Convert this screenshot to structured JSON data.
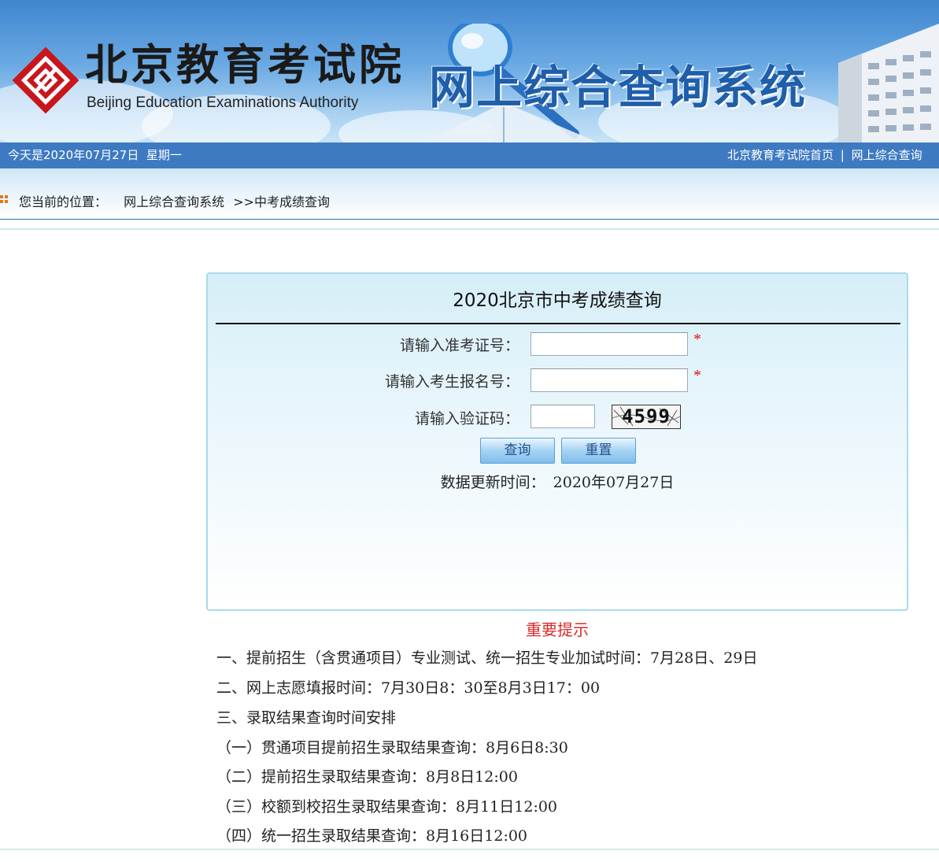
{
  "header": {
    "org_name_cn": "北京教育考试院",
    "org_name_en": "Beijing Education Examinations Authority",
    "system_title": "网上综合查询系统",
    "logo_icon": "beijing-education-exam-logo-icon",
    "colors": {
      "banner_blue": "#3d7ac2",
      "title_blue": "#1f5ea8",
      "logo_red": "#c8161d"
    }
  },
  "datebar": {
    "date_text": "今天是2020年07月27日  星期一",
    "link_home": "北京教育考试院首页",
    "link_sep": "|",
    "link_query": "网上综合查询"
  },
  "breadcrumb": {
    "prefix": "您当前的位置：",
    "item1": "网上综合查询系统",
    "item2": ">>中考成绩查询"
  },
  "panel": {
    "title": "2020北京市中考成绩查询",
    "exam_id_label": "请输入准考证号：",
    "exam_id_value": "",
    "reg_no_label": "请输入考生报名号：",
    "reg_no_value": "",
    "captcha_label": "请输入验证码：",
    "captcha_value": "",
    "captcha_text": "4599",
    "required_mark": "*",
    "query_button": "查询",
    "reset_button": "重置",
    "update_label": "数据更新时间：",
    "update_value": "2020年07月27日"
  },
  "notice": {
    "title": "重要提示",
    "lines": [
      "一、提前招生（含贯通项目）专业测试、统一招生专业加试时间：7月28日、29日",
      "二、网上志愿填报时间：7月30日8：30至8月3日17：00",
      "三、录取结果查询时间安排",
      "（一）贯通项目提前招生录取结果查询：8月6日8:30",
      "（二）提前招生录取结果查询：8月8日12:00",
      "（三）校额到校招生录取结果查询：8月11日12:00",
      "（四）统一招生录取结果查询：8月16日12:00"
    ],
    "colors": {
      "title_red": "#d92b2b"
    }
  }
}
